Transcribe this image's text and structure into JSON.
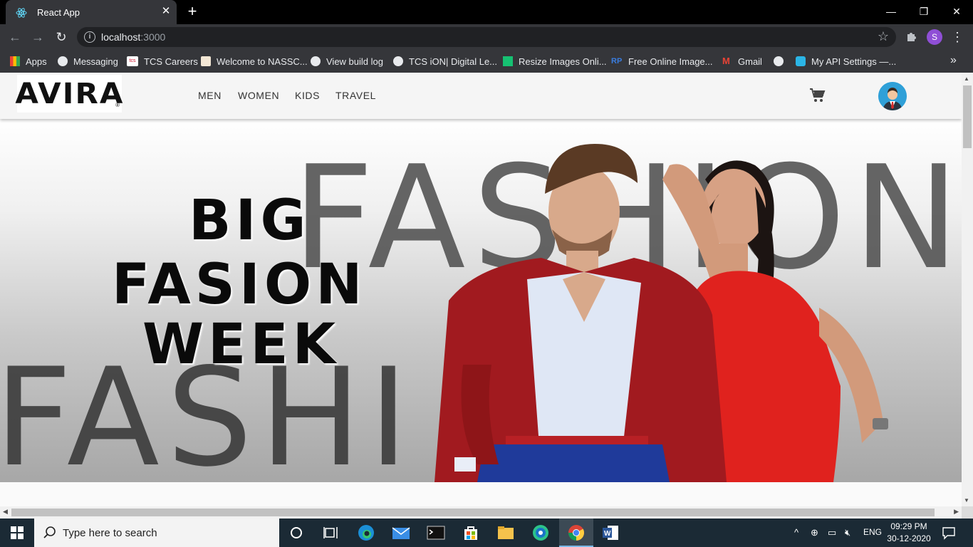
{
  "browser": {
    "tab_title": "React App",
    "url_host": "localhost",
    "url_port": ":3000",
    "bookmarks": [
      {
        "label": "Apps",
        "icon": "apps-grid-icon"
      },
      {
        "label": "Messaging",
        "icon": "globe-icon"
      },
      {
        "label": "TCS Careers",
        "icon": "tcs-icon"
      },
      {
        "label": "Welcome to NASSC...",
        "icon": "nasscom-icon"
      },
      {
        "label": "View build log",
        "icon": "globe-icon"
      },
      {
        "label": "TCS iON| Digital Le...",
        "icon": "globe-icon"
      },
      {
        "label": "Resize Images Onli...",
        "icon": "resize-icon"
      },
      {
        "label": "Free Online Image...",
        "icon": "rp-icon"
      },
      {
        "label": "Gmail",
        "icon": "gmail-icon"
      },
      {
        "label": "",
        "icon": "globe-icon"
      },
      {
        "label": "My API Settings —...",
        "icon": "api-icon"
      }
    ],
    "profile_initial": "S"
  },
  "app": {
    "logo_text": "AVIRA",
    "logo_mark": "®",
    "nav": [
      "MEN",
      "WOMEN",
      "KIDS",
      "TRAVEL"
    ],
    "hero": {
      "background_words": [
        "FASHION",
        "FASHI"
      ],
      "slogan": [
        "BIG",
        "FASION",
        "WEEK"
      ]
    }
  },
  "taskbar": {
    "search_placeholder": "Type here to search",
    "language": "ENG",
    "time": "09:29 PM",
    "date": "30-12-2020"
  },
  "colors": {
    "accent_avatar": "#2fa0d8",
    "dress_red": "#e0221e",
    "jacket_red": "#a11a1f"
  }
}
